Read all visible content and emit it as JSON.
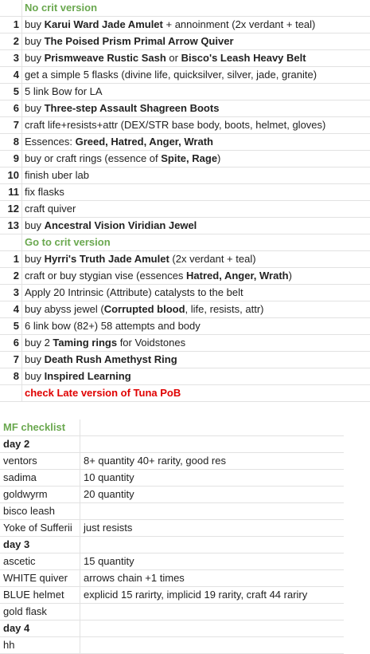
{
  "section1": {
    "header": "No crit version",
    "rows": [
      {
        "n": "1",
        "parts": [
          [
            "buy ",
            false
          ],
          [
            "Karui Ward Jade Amulet",
            true
          ],
          [
            " + annoinment (2x verdant + teal)",
            false
          ]
        ]
      },
      {
        "n": "2",
        "parts": [
          [
            "buy ",
            false
          ],
          [
            "The Poised Prism Primal Arrow Quiver",
            true
          ]
        ]
      },
      {
        "n": "3",
        "parts": [
          [
            "buy ",
            false
          ],
          [
            "Prismweave Rustic Sash",
            true
          ],
          [
            " or ",
            false
          ],
          [
            "Bisco's Leash Heavy Belt",
            true
          ]
        ]
      },
      {
        "n": "4",
        "parts": [
          [
            "get a simple 5 flasks (divine life, quicksilver, silver, jade, granite)",
            false
          ]
        ]
      },
      {
        "n": "5",
        "parts": [
          [
            "5 link Bow for LA",
            false
          ]
        ]
      },
      {
        "n": "6",
        "parts": [
          [
            "buy ",
            false
          ],
          [
            "Three-step Assault Shagreen Boots",
            true
          ]
        ]
      },
      {
        "n": "7",
        "parts": [
          [
            "craft life+resists+attr (DEX/STR base body, boots, helmet, gloves)",
            false
          ]
        ]
      },
      {
        "n": "8",
        "parts": [
          [
            "Essences: ",
            false
          ],
          [
            "Greed, Hatred, Anger, Wrath",
            true
          ]
        ]
      },
      {
        "n": "9",
        "parts": [
          [
            "buy or craft rings (essence of ",
            false
          ],
          [
            "Spite, Rage",
            true
          ],
          [
            ")",
            false
          ]
        ]
      },
      {
        "n": "10",
        "parts": [
          [
            "finish uber lab",
            false
          ]
        ]
      },
      {
        "n": "11",
        "parts": [
          [
            "fix flasks",
            false
          ]
        ]
      },
      {
        "n": "12",
        "parts": [
          [
            "craft quiver",
            false
          ]
        ]
      },
      {
        "n": "13",
        "parts": [
          [
            "buy ",
            false
          ],
          [
            "Ancestral Vision Viridian Jewel",
            true
          ]
        ]
      }
    ]
  },
  "section2": {
    "header": "Go to crit version",
    "rows": [
      {
        "n": "1",
        "parts": [
          [
            "buy ",
            false
          ],
          [
            "Hyrri's Truth Jade Amulet",
            true
          ],
          [
            " (2x verdant + teal)",
            false
          ]
        ]
      },
      {
        "n": "2",
        "parts": [
          [
            "craft or buy stygian vise (essences ",
            false
          ],
          [
            "Hatred, Anger, Wrath",
            true
          ],
          [
            ")",
            false
          ]
        ]
      },
      {
        "n": "3",
        "parts": [
          [
            "Apply 20 Intrinsic (Attribute) catalysts to the belt",
            false
          ]
        ]
      },
      {
        "n": "4",
        "parts": [
          [
            "buy abyss jewel (",
            false
          ],
          [
            "Corrupted blood",
            true
          ],
          [
            ", life, resists, attr)",
            false
          ]
        ]
      },
      {
        "n": "5",
        "parts": [
          [
            "6 link bow (82+) 58 attempts and body",
            false
          ]
        ]
      },
      {
        "n": "6",
        "parts": [
          [
            "buy 2 ",
            false
          ],
          [
            "Taming rings",
            true
          ],
          [
            " for Voidstones",
            false
          ]
        ]
      },
      {
        "n": "7",
        "parts": [
          [
            "buy ",
            false
          ],
          [
            "Death Rush Amethyst Ring",
            true
          ]
        ]
      },
      {
        "n": "8",
        "parts": [
          [
            "buy ",
            false
          ],
          [
            "Inspired Learning",
            true
          ]
        ]
      }
    ],
    "footer": "check Late version of Tuna PoB"
  },
  "mf": {
    "title": "MF checklist",
    "rows": [
      {
        "a": "day 2",
        "b": "",
        "day": true
      },
      {
        "a": "ventors",
        "b": "8+ quantity 40+ rarity, good res"
      },
      {
        "a": "sadima",
        "b": "10 quantity"
      },
      {
        "a": "goldwyrm",
        "b": "20 quantity"
      },
      {
        "a": "bisco leash",
        "b": ""
      },
      {
        "a": "Yoke of Sufferii",
        "b": "just resists"
      },
      {
        "a": "day 3",
        "b": "",
        "day": true
      },
      {
        "a": "ascetic",
        "b": "15 quantity"
      },
      {
        "a": "WHITE quiver",
        "b": "arrows chain +1 times"
      },
      {
        "a": "BLUE helmet",
        "b": "explicid 15 rarirty, implicid 19 rarity, craft 44 rariry"
      },
      {
        "a": "gold flask",
        "b": ""
      },
      {
        "a": "day 4",
        "b": "",
        "day": true
      },
      {
        "a": "hh",
        "b": ""
      }
    ]
  }
}
